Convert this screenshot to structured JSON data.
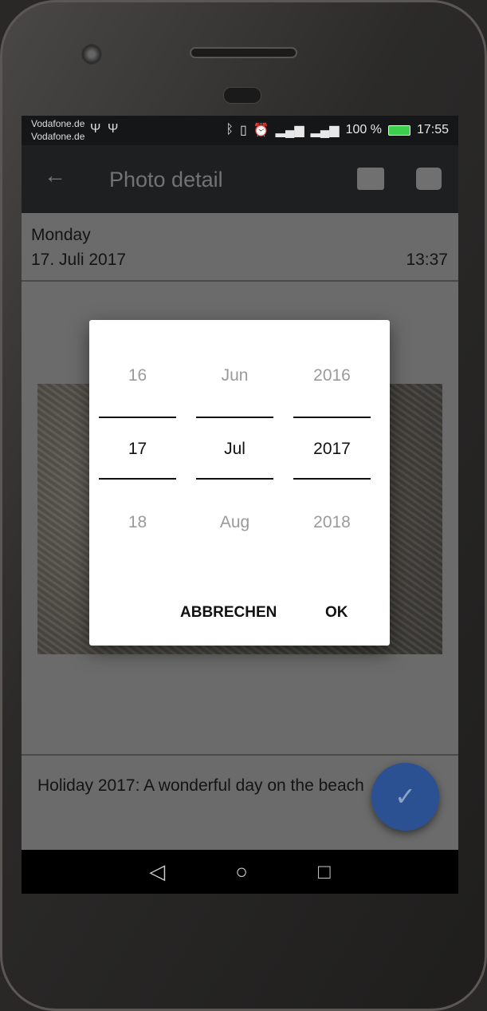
{
  "status_bar": {
    "carrier1": "Vodafone.de",
    "carrier2": "Vodafone.de",
    "battery": "100 %",
    "time": "17:55",
    "icons": [
      "usb-icon",
      "usb-icon",
      "bluetooth-icon",
      "vibrate-icon",
      "alarm-icon",
      "signal-icon",
      "4g-signal-icon",
      "battery-icon"
    ]
  },
  "toolbar": {
    "title": "Photo detail",
    "icons": [
      "back-arrow-icon",
      "gallery-icon",
      "camera-icon"
    ]
  },
  "date": {
    "weekday": "Monday",
    "date": "17. Juli 2017",
    "time": "13:37"
  },
  "caption": "Holiday 2017: A wonderful day on the beach",
  "picker": {
    "day": {
      "prev": "16",
      "cur": "17",
      "next": "18"
    },
    "month": {
      "prev": "Jun",
      "cur": "Jul",
      "next": "Aug"
    },
    "year": {
      "prev": "2016",
      "cur": "2017",
      "next": "2018"
    },
    "cancel": "ABBRECHEN",
    "ok": "OK"
  },
  "colors": {
    "fab": "#2c5193",
    "toolbar": "#1e1f21"
  }
}
